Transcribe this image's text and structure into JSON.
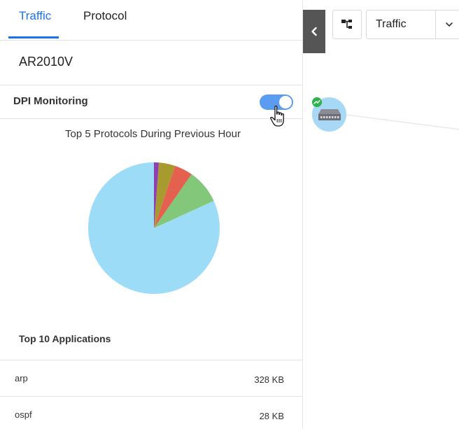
{
  "tabs": [
    {
      "label": "Traffic",
      "active": true
    },
    {
      "label": "Protocol",
      "active": false
    }
  ],
  "device": {
    "name": "AR2010V"
  },
  "dpi": {
    "label": "DPI Monitoring",
    "enabled": true
  },
  "chart_data": {
    "type": "pie",
    "title": "Top 5 Protocols During Previous Hour",
    "categories": [
      "",
      "",
      "",
      "",
      ""
    ],
    "values": [
      0.818,
      0.085,
      0.045,
      0.04,
      0.012
    ],
    "colors": [
      "#9ddcf7",
      "#82c77a",
      "#e4604f",
      "#a79a2f",
      "#8e3fb2"
    ]
  },
  "applications": {
    "title": "Top 10 Applications",
    "items": [
      {
        "name": "arp",
        "value": "328 KB"
      },
      {
        "name": "ospf",
        "value": "28 KB"
      }
    ]
  },
  "toolbar": {
    "view_select": "Traffic"
  },
  "icons": {
    "collapse": "chevron-left-icon",
    "tree": "topology-tree-icon",
    "select": "chevron-down-icon",
    "cursor": "hand-pointer-icon",
    "device": "router-icon"
  },
  "colors": {
    "accent": "#1a73e8",
    "toggle": "#5b9cf0",
    "node": "#a7d8f5",
    "status_ok": "#2db34a",
    "collapse_bg": "#555555"
  }
}
